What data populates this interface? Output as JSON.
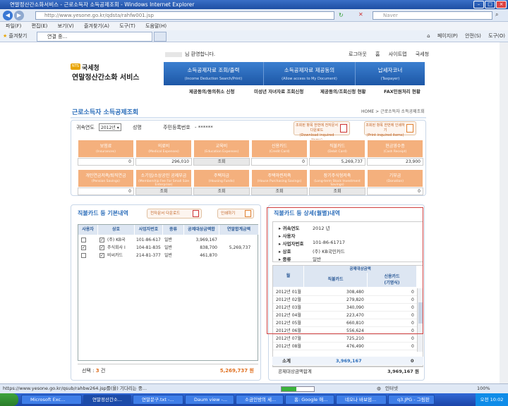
{
  "window": {
    "title": "연말정산간소화서비스 - 근로소득자 소득공제조회 - Windows Internet Explorer"
  },
  "address": {
    "url": "http://www.yesone.go.kr/qdsta/rahfw001.jsp",
    "search_placeholder": "Naver"
  },
  "menu": [
    "파일(F)",
    "편집(E)",
    "보기(V)",
    "즐겨찾기(A)",
    "도구(T)",
    "도움말(H)"
  ],
  "favorites": {
    "label": "즐겨찾기",
    "tab": "연결 중...",
    "commands": [
      "페이지(P)",
      "안전(S)",
      "도구(O)"
    ]
  },
  "site": {
    "welcome": "님 환영합니다.",
    "toplinks": [
      "로그아웃",
      "홈",
      "사이트맵",
      "국세청"
    ],
    "logo_badge": "NTS",
    "org": "국세청",
    "service": "연말정산간소화 서비스",
    "nav": [
      {
        "k": "소득공제자료 조회/출력",
        "e": "(Income Deduction Search/Print)"
      },
      {
        "k": "소득공제자료 제공동의",
        "e": "(Allow access to My Document)"
      },
      {
        "k": "납세자코너",
        "e": "(Taxpayer)"
      }
    ],
    "subnav": [
      "제공동의/동의취소 신청",
      "미성년 자녀자료 조회신청",
      "제공동의/조회신청 현황",
      "FAX민원처리 현황"
    ],
    "page_title": "근로소득자 소득공제조회",
    "breadcrumb": "HOME > 근로소득자 소득공제조회"
  },
  "condition": {
    "year_label": "귀속연도",
    "year_value": "2012년",
    "name_label": "성명",
    "id_label": "주민등록번호",
    "id_value": "- ******",
    "download_label": "조회된 항목 한번에 전자문서 다운로드",
    "download_en": "(Download inquired items)",
    "print_label": "조회된 항목 한번에 인쇄하기",
    "print_en": "(Print inquired items)"
  },
  "deductions": [
    {
      "k": "보험료",
      "e": "(Insurances)",
      "v": "0"
    },
    {
      "k": "의료비",
      "e": "(Medical Expenses)",
      "v": "296,010"
    },
    {
      "k": "교육비",
      "e": "(Education Expenses)",
      "v": "조회"
    },
    {
      "k": "신용카드",
      "e": "(Credit Card)",
      "v": "0"
    },
    {
      "k": "직불카드",
      "e": "(Debit Card)",
      "v": "5,269,737"
    },
    {
      "k": "현금영수증",
      "e": "(Cash Receipt)",
      "v": "23,900"
    },
    {
      "k": "개인연금저축/퇴직연금",
      "e": "(Pension Savings)",
      "v": "0"
    },
    {
      "k": "소기업/소상공인 공제부금",
      "e": "(Membership Fee For Small Size Enterprise)",
      "v": "조회"
    },
    {
      "k": "주택자금",
      "e": "(Housing Funds)",
      "v": "조회"
    },
    {
      "k": "주택마련저축",
      "e": "(House Purchasing Savings)",
      "v": "조회"
    },
    {
      "k": "장기주식형저축",
      "e": "(Long-term Stock Investment Savings)",
      "v": "조회"
    },
    {
      "k": "기부금",
      "e": "(Donation)",
      "v": "0"
    }
  ],
  "basic": {
    "title": "직불카드 등 기본내역",
    "download_btn": "전자문서 다운로드",
    "print_btn": "인쇄하기",
    "headers": [
      "사용자",
      "상호",
      "사업자번호",
      "종류",
      "공제대상금액합",
      "연말합계금액"
    ],
    "rows": [
      {
        "checked": false,
        "name": "(주) KB국",
        "bizno": "101-86-617",
        "kind": "일반",
        "amount": "3,969,167",
        "total": ""
      },
      {
        "checked": true,
        "name": "주식회사 I",
        "bizno": "104-81-835",
        "kind": "일반",
        "amount": "838,700",
        "total": "5,269,737"
      },
      {
        "checked": false,
        "name": "비씨카드",
        "bizno": "214-81-377",
        "kind": "일반",
        "amount": "461,870",
        "total": ""
      }
    ],
    "select_label": "선택 : ",
    "select_count": "3",
    "select_unit": "건",
    "sum": "5,269,737 원"
  },
  "detail": {
    "title": "직불카드 등 상세(월별)내역",
    "fields": [
      {
        "label": "귀속연도",
        "value": "2012 년"
      },
      {
        "label": "사용자",
        "value": ""
      },
      {
        "label": "사업자번호",
        "value": "101-86-61717"
      },
      {
        "label": "상호",
        "value": "(주) KB국민카드"
      },
      {
        "label": "종류",
        "value": "일반"
      }
    ],
    "col_month": "월",
    "col_group": "공제대상금액",
    "col_debit": "직불카드",
    "col_credit": "신용카드",
    "col_credit_sub": "(기명식)",
    "months": [
      {
        "m": "2012년 01월",
        "debit": "308,480",
        "credit": "0"
      },
      {
        "m": "2012년 02월",
        "debit": "279,820",
        "credit": "0"
      },
      {
        "m": "2012년 03월",
        "debit": "340,090",
        "credit": "0"
      },
      {
        "m": "2012년 04월",
        "debit": "223,470",
        "credit": "0"
      },
      {
        "m": "2012년 05월",
        "debit": "660,810",
        "credit": "0"
      },
      {
        "m": "2012년 06월",
        "debit": "556,624",
        "credit": "0"
      },
      {
        "m": "2012년 07월",
        "debit": "725,210",
        "credit": "0"
      },
      {
        "m": "2012년 08월",
        "debit": "476,490",
        "credit": "0"
      }
    ],
    "subtotal_label": "소계",
    "subtotal_debit": "3,969,167",
    "subtotal_credit": "0",
    "grand_label": "공제대상금액합계",
    "grand_value": "3,969,167 원"
  },
  "status": {
    "text": "https://www.yesone.go.kr/qsub/rahbw264.jsp를(을) 기다리는 중...",
    "zone": "인터넷",
    "zoom": "100%",
    "progress": 0.45
  },
  "taskbar": {
    "tasks": [
      "Microsoft Exc...",
      "연말정산간소...",
      "연말문구.txt -...",
      "Daum view -...",
      "소금인방의 세...",
      "홈: Google 애...",
      "네오나 바보엄...",
      "q3.JPG - 그림판"
    ],
    "clock": "오전 10:02"
  }
}
